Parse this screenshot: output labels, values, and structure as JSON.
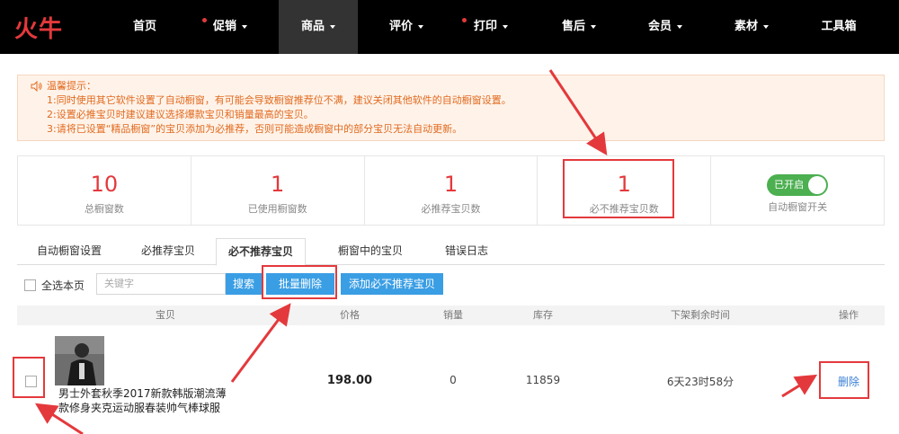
{
  "logo": {
    "text": "火牛"
  },
  "nav": [
    {
      "label": "首页",
      "caret": false,
      "dot": false
    },
    {
      "label": "促销",
      "caret": true,
      "dot": true
    },
    {
      "label": "商品",
      "caret": true,
      "dot": false,
      "active": true
    },
    {
      "label": "评价",
      "caret": true,
      "dot": false
    },
    {
      "label": "打印",
      "caret": true,
      "dot": true
    },
    {
      "label": "售后",
      "caret": true,
      "dot": false
    },
    {
      "label": "会员",
      "caret": true,
      "dot": false
    },
    {
      "label": "素材",
      "caret": true,
      "dot": false
    },
    {
      "label": "工具箱",
      "caret": false,
      "dot": false
    }
  ],
  "notice": {
    "title": "温馨提示：",
    "lines": [
      "1:同时使用其它软件设置了自动橱窗，有可能会导致橱窗推荐位不满，建议关闭其他软件的自动橱窗设置。",
      "2:设置必推宝贝时建议建议选择爆款宝贝和销量最高的宝贝。",
      "3:请将已设置“精品橱窗”的宝贝添加为必推荐，否则可能造成橱窗中的部分宝贝无法自动更新。"
    ]
  },
  "stats": [
    {
      "num": "10",
      "label": "总橱窗数"
    },
    {
      "num": "1",
      "label": "已使用橱窗数"
    },
    {
      "num": "1",
      "label": "必推荐宝贝数"
    },
    {
      "num": "1",
      "label": "必不推荐宝贝数"
    }
  ],
  "auto_switch": {
    "state": "已开启",
    "label": "自动橱窗开关"
  },
  "tabs": [
    "自动橱窗设置",
    "必推荐宝贝",
    "必不推荐宝贝",
    "橱窗中的宝贝",
    "错误日志"
  ],
  "toolbar": {
    "select_all": "全选本页",
    "search_placeholder": "关键字",
    "search_btn": "搜索",
    "batch_delete_btn": "批量删除",
    "add_btn": "添加必不推荐宝贝"
  },
  "table": {
    "headers": {
      "item": "宝贝",
      "price": "价格",
      "sales": "销量",
      "stock": "库存",
      "remaining": "下架剩余时间",
      "action": "操作"
    },
    "rows": [
      {
        "title": "男士外套秋季2017新款韩版潮流薄款修身夹克运动服春装帅气棒球服",
        "price": "198.00",
        "sales": "0",
        "stock": "11859",
        "remaining": "6天23时58分",
        "action": "删除"
      }
    ]
  },
  "colors": {
    "nav_bg": "#000000",
    "brand_red": "#e4393c",
    "button_blue": "#3a9ee4",
    "toggle_green": "#4caf50",
    "notice_text": "#e06a20"
  }
}
